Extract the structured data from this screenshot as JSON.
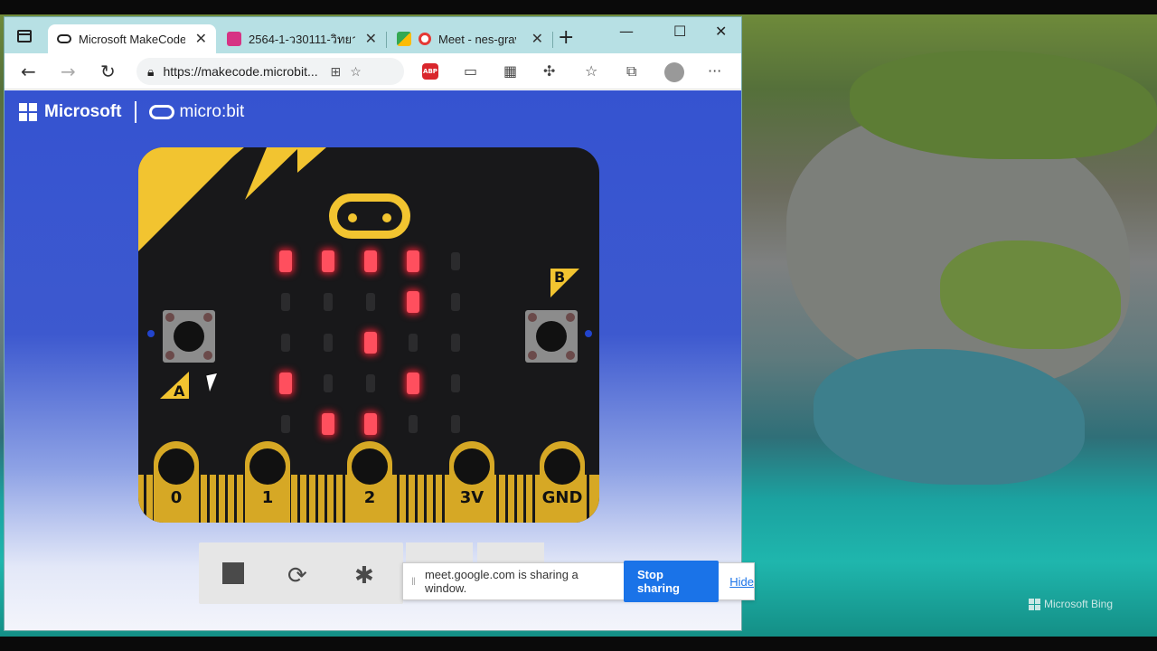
{
  "browser": {
    "tabs": [
      {
        "label": "Microsoft MakeCode f",
        "icon": "makecode-icon",
        "active": true
      },
      {
        "label": "2564-1-ว30111-วิทยาก",
        "icon": "classroom-icon",
        "active": false
      },
      {
        "label": "Meet - nes-grav-",
        "icon": "meet-icon",
        "active": false
      }
    ],
    "new_tab": "+",
    "window_controls": {
      "minimize": "—",
      "maximize": "☐",
      "close": "✕"
    },
    "address": "https://makecode.microbit...",
    "extension_badge": "ABP"
  },
  "page": {
    "brand_microsoft": "Microsoft",
    "brand_product": "micro:bit",
    "led_matrix": [
      [
        1,
        1,
        1,
        1,
        0
      ],
      [
        0,
        0,
        0,
        1,
        0
      ],
      [
        0,
        0,
        1,
        0,
        0
      ],
      [
        1,
        0,
        0,
        1,
        0
      ],
      [
        0,
        1,
        1,
        0,
        0
      ]
    ],
    "button_a": "A",
    "button_b": "B",
    "pins": [
      "0",
      "1",
      "2",
      "3V",
      "GND"
    ],
    "controls": [
      "stop-icon",
      "restart-icon",
      "debug-icon"
    ]
  },
  "share_bar": {
    "message": "meet.google.com is sharing a window.",
    "stop_label": "Stop sharing",
    "hide_label": "Hide"
  },
  "desktop": {
    "watermark": "Microsoft Bing"
  },
  "colors": {
    "page_blue": "#3553d0",
    "board_yellow": "#f2c430",
    "led_on": "#ff4f5e",
    "stop_sharing": "#1a73e8"
  }
}
